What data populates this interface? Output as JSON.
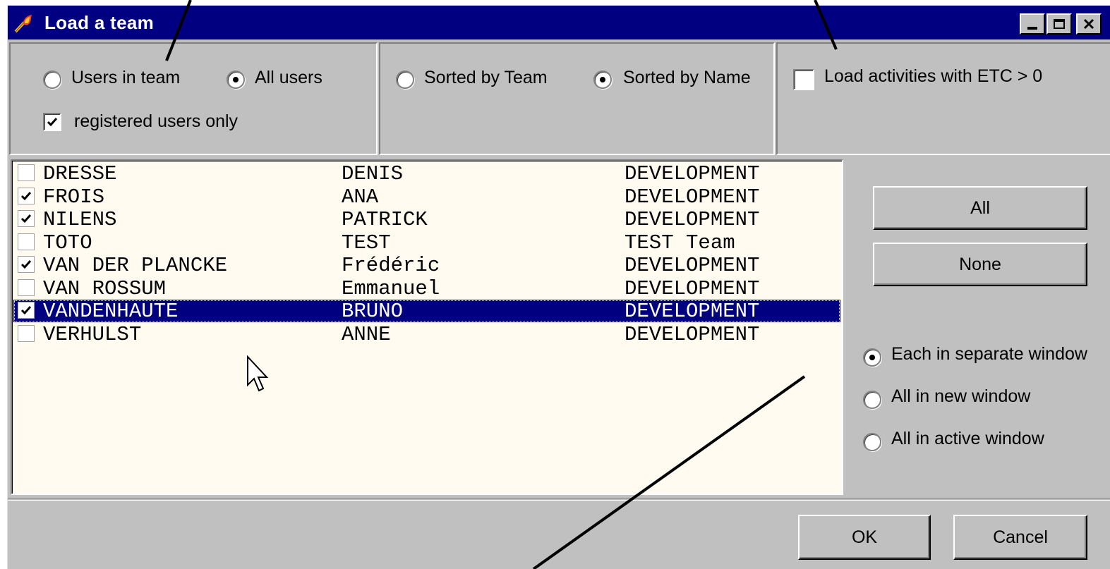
{
  "window": {
    "title": "Load a team"
  },
  "filters": {
    "users_in_team_label": "Users in team",
    "all_users_label": "All users",
    "registered_only_label": "registered users only",
    "sorted_by_team_label": "Sorted by Team",
    "sorted_by_name_label": "Sorted by Name",
    "load_etc_label": "Load activities with ETC > 0"
  },
  "users": [
    {
      "last": "DRESSE",
      "first": "DENIS",
      "team": "DEVELOPMENT",
      "checked": false,
      "selected": false
    },
    {
      "last": "FROIS",
      "first": "ANA",
      "team": "DEVELOPMENT",
      "checked": true,
      "selected": false
    },
    {
      "last": "NILENS",
      "first": "PATRICK",
      "team": "DEVELOPMENT",
      "checked": true,
      "selected": false
    },
    {
      "last": "TOTO",
      "first": "TEST",
      "team": "TEST Team",
      "checked": false,
      "selected": false
    },
    {
      "last": "VAN DER PLANCKE",
      "first": "Frédéric",
      "team": "DEVELOPMENT",
      "checked": true,
      "selected": false
    },
    {
      "last": "VAN ROSSUM",
      "first": "Emmanuel",
      "team": "DEVELOPMENT",
      "checked": false,
      "selected": false
    },
    {
      "last": "VANDENHAUTE",
      "first": "BRUNO",
      "team": "DEVELOPMENT",
      "checked": true,
      "selected": true
    },
    {
      "last": "VERHULST",
      "first": "ANNE",
      "team": "DEVELOPMENT",
      "checked": false,
      "selected": false
    }
  ],
  "selection_buttons": {
    "all_label": "All",
    "none_label": "None"
  },
  "window_options": {
    "separate_label": "Each in separate window",
    "new_label": "All in new window",
    "active_label": "All in active window"
  },
  "dialog_buttons": {
    "ok_label": "OK",
    "cancel_label": "Cancel"
  },
  "colors": {
    "titlebar": "#000080",
    "face": "#c0c0c0",
    "list_background": "#fffbf0",
    "selection": "#000080"
  }
}
